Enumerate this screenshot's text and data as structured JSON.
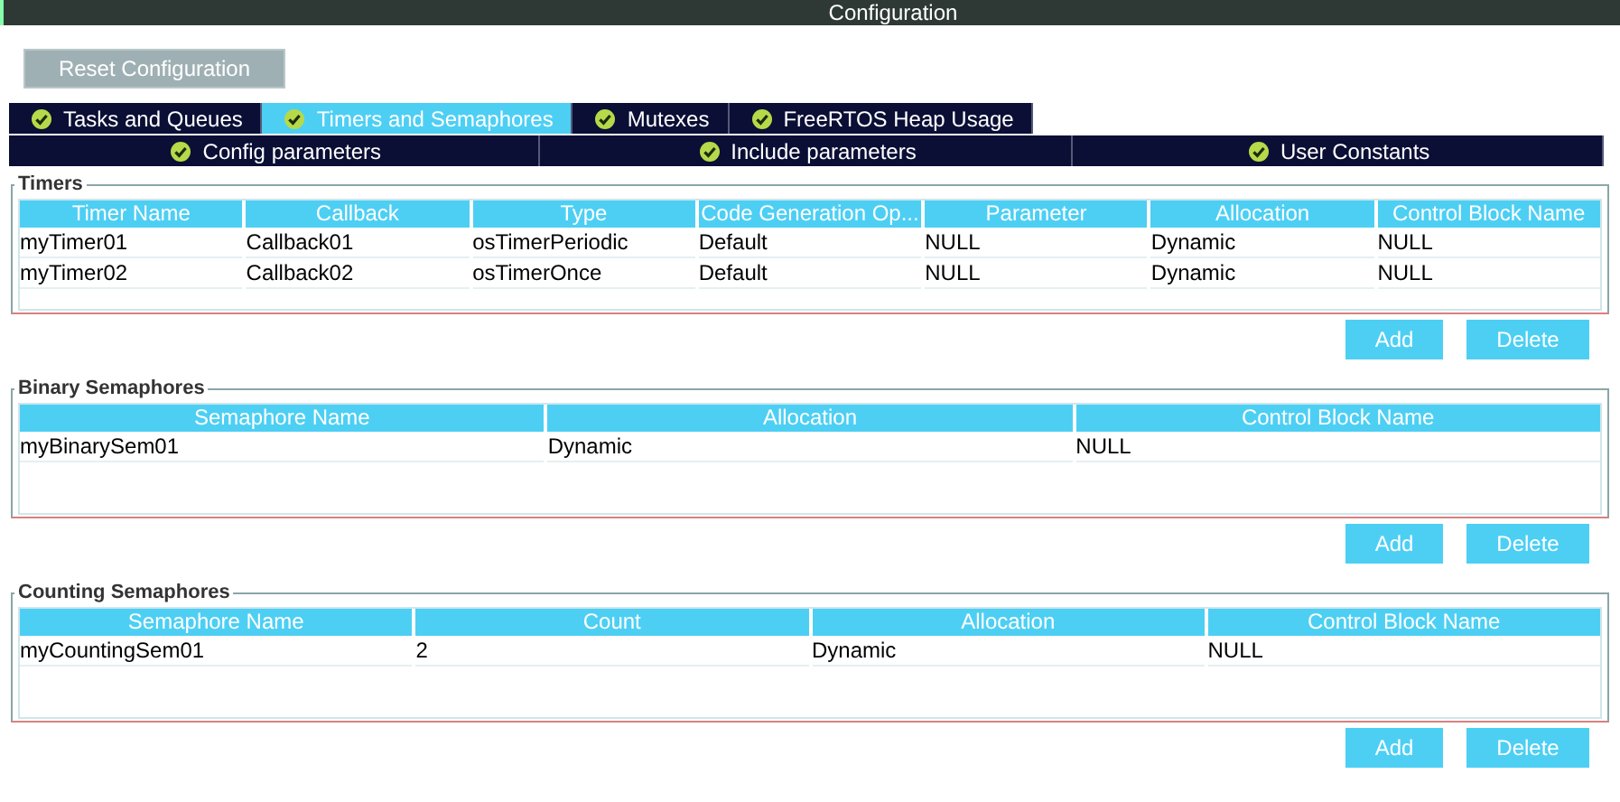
{
  "window": {
    "title": "Configuration"
  },
  "reset_button": "Reset Configuration",
  "tabs": [
    {
      "label": "Tasks and Queues",
      "selected": false
    },
    {
      "label": "Timers and Semaphores",
      "selected": true
    },
    {
      "label": "Mutexes",
      "selected": false
    },
    {
      "label": "FreeRTOS Heap Usage",
      "selected": false
    }
  ],
  "subtabs": [
    {
      "label": "Config parameters",
      "selected": false
    },
    {
      "label": "Include parameters",
      "selected": false
    },
    {
      "label": "User Constants",
      "selected": false
    }
  ],
  "sections": [
    {
      "title": "Timers",
      "columns": [
        "Timer Name",
        "Callback",
        "Type",
        "Code Generation Op...",
        "Parameter",
        "Allocation",
        "Control Block Name"
      ],
      "rows": [
        [
          "myTimer01",
          "Callback01",
          "osTimerPeriodic",
          "Default",
          "NULL",
          "Dynamic",
          "NULL"
        ],
        [
          "myTimer02",
          "Callback02",
          "osTimerOnce",
          "Default",
          "NULL",
          "Dynamic",
          "NULL"
        ]
      ],
      "buttons": [
        "Add",
        "Delete"
      ]
    },
    {
      "title": "Binary Semaphores",
      "columns": [
        "Semaphore Name",
        "Allocation",
        "Control Block Name"
      ],
      "rows": [
        [
          "myBinarySem01",
          "Dynamic",
          "NULL"
        ]
      ],
      "buttons": [
        "Add",
        "Delete"
      ]
    },
    {
      "title": "Counting Semaphores",
      "columns": [
        "Semaphore Name",
        "Count",
        "Allocation",
        "Control Block Name"
      ],
      "rows": [
        [
          "myCountingSem01",
          "2",
          "Dynamic",
          "NULL"
        ]
      ],
      "buttons": [
        "Add",
        "Delete"
      ]
    }
  ]
}
